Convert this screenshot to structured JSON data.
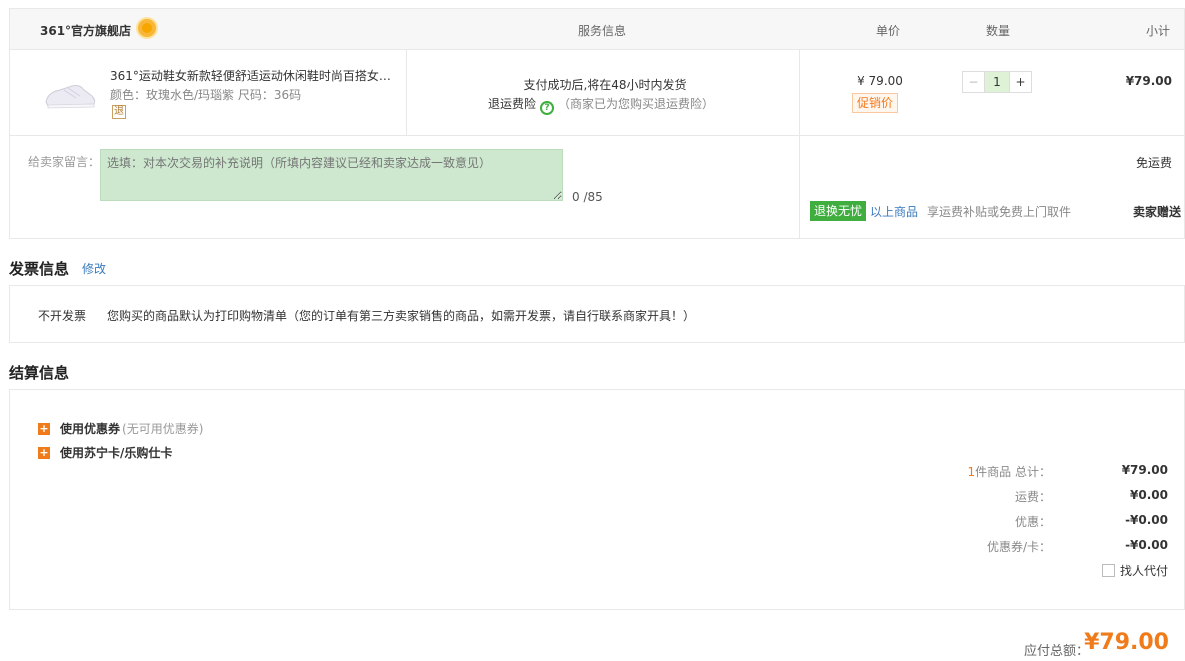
{
  "header": {
    "store": "361°官方旗舰店",
    "service": "服务信息",
    "unit_price": "单价",
    "quantity": "数量",
    "subtotal": "小计"
  },
  "item": {
    "name": "361°运动鞋女新款轻便舒适运动休闲鞋时尚百搭女…",
    "attrs": "颜色：玫瑰水色/玛瑙紫   尺码：36码",
    "return_badge": "退",
    "shipping": "支付成功后,将在48小时内发货",
    "insurance": "退运费险",
    "insurance_icon_text": "?",
    "insurance_note": "（商家已为您购买退运费险）",
    "price": "¥ 79.00",
    "promo": "促销价",
    "qty": "1",
    "minus": "−",
    "plus": "+",
    "subtotal": "¥79.00"
  },
  "message": {
    "label": "给卖家留言：",
    "placeholder": "选填：对本次交易的补充说明（所填内容建议已经和卖家达成一致意见）",
    "count": "0 /85",
    "free_shipping": "免运费",
    "tag": "退换无忧",
    "above": "以上商品",
    "above_desc": "享运费补贴或免费上门取件",
    "gift": "卖家赠送"
  },
  "invoice": {
    "title": "发票信息",
    "edit": "修改",
    "label": "不开发票",
    "desc": "您购买的商品默认为打印购物清单（您的订单有第三方卖家销售的商品，如需开发票，请自行联系商家开具！）"
  },
  "settlement": {
    "title": "结算信息",
    "coupon_label": "使用优惠券",
    "coupon_note": "(无可用优惠券)",
    "card_label": "使用苏宁卡/乐购仕卡",
    "plus_icon": "+",
    "count": "1",
    "goods_total_label": "件商品 总计：",
    "goods_total": "¥79.00",
    "freight_label": "运费：",
    "freight": "¥0.00",
    "discount_label": "优惠：",
    "discount": "-¥0.00",
    "coupon_card_label": "优惠券/卡：",
    "coupon_card": "-¥0.00",
    "proxy_pay": "找人代付",
    "payable_label": "应付总额：",
    "payable": "¥79.00"
  },
  "colors": {
    "accent_orange": "#f07b1a",
    "link_blue": "#3a7bbf",
    "tag_green": "#3fae3f"
  },
  "icons": [
    "sun-icon",
    "help-icon",
    "plus-icon",
    "checkbox-icon"
  ]
}
